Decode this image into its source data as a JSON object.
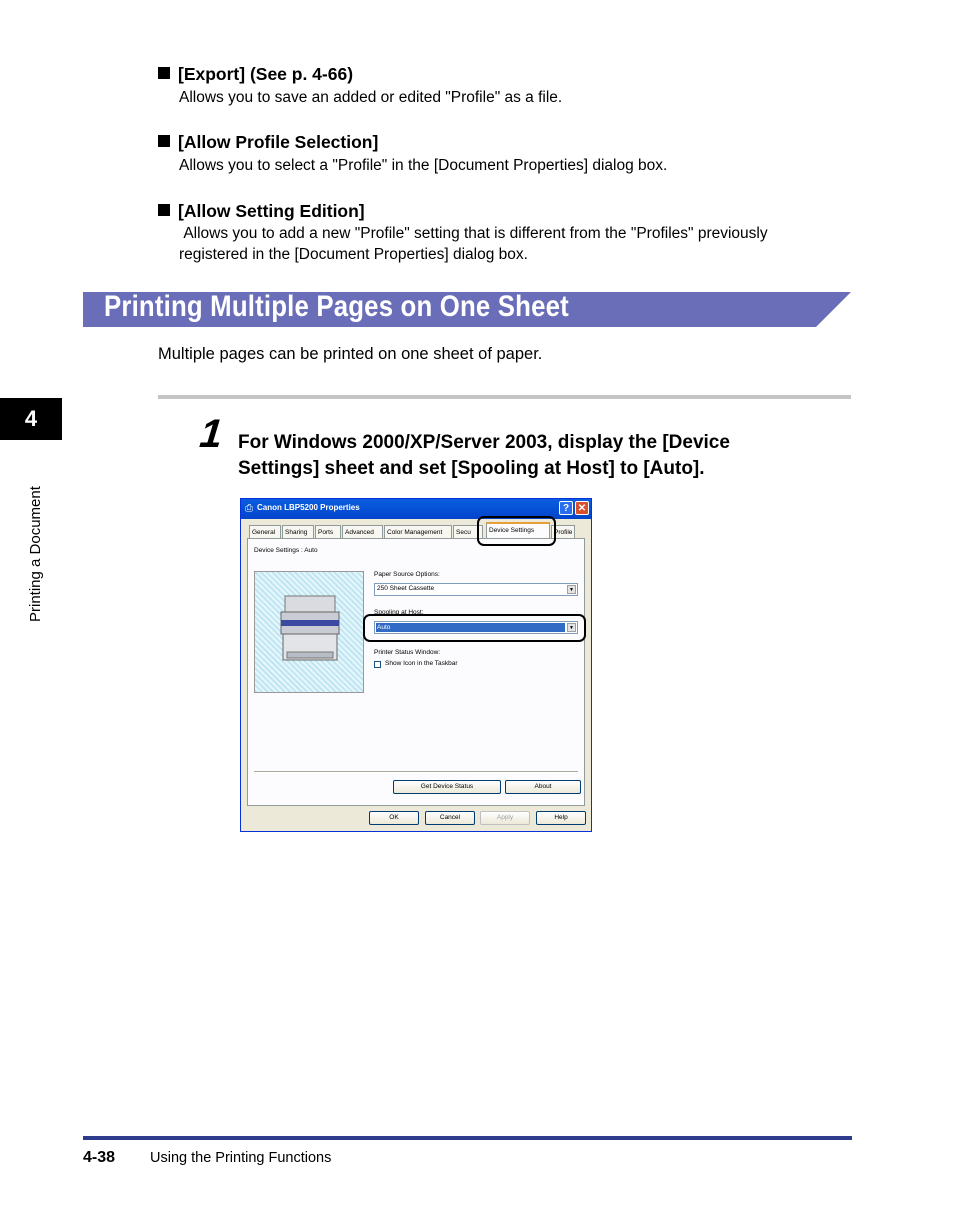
{
  "items": [
    {
      "heading": "[Export] (See p. 4-66)",
      "description": "Allows you to save an added or edited \"Profile\" as a file."
    },
    {
      "heading": "[Allow Profile Selection]",
      "description": "Allows you to select a \"Profile\" in the [Document Properties] dialog box."
    },
    {
      "heading": "[Allow Setting Edition]",
      "description": " Allows you to add a new \"Profile\" setting that is different from the \"Profiles\" previously registered in the [Document Properties] dialog box."
    }
  ],
  "section": {
    "title": "Printing Multiple Pages on One Sheet",
    "intro": "Multiple pages can be printed on one sheet of paper.",
    "bar_color": "#6a6db8"
  },
  "chapter": {
    "number": "4",
    "label": "Printing a Document"
  },
  "step": {
    "number": "1",
    "text": "For Windows 2000/XP/Server 2003, display the [Device Settings] sheet and set [Spooling at Host] to [Auto]."
  },
  "dialog": {
    "title": "Canon LBP5200 Properties",
    "title_icon": "printer-icon",
    "tabs": [
      "General",
      "Sharing",
      "Ports",
      "Advanced",
      "Color Management",
      "Secu",
      "Device Settings",
      "Profile"
    ],
    "selected_tab": "Device Settings",
    "device_settings_label": "Device Settings : Auto",
    "paper_source_label": "Paper Source Options:",
    "paper_source_value": "250 Sheet Cassette",
    "spooling_label": "Spooling at Host:",
    "spooling_value": "Auto",
    "printer_status_label": "Printer Status Window:",
    "show_icon_label": "Show Icon in the Taskbar",
    "show_icon_checked": false,
    "get_status_button": "Get Device Status",
    "about_button": "About",
    "ok_button": "OK",
    "cancel_button": "Cancel",
    "apply_button": "Apply",
    "help_button": "Help",
    "help_icon": "question-icon",
    "close_icon": "close-icon"
  },
  "footer": {
    "page_number": "4-38",
    "title": "Using the Printing Functions",
    "rule_color": "#2e3a8c"
  }
}
